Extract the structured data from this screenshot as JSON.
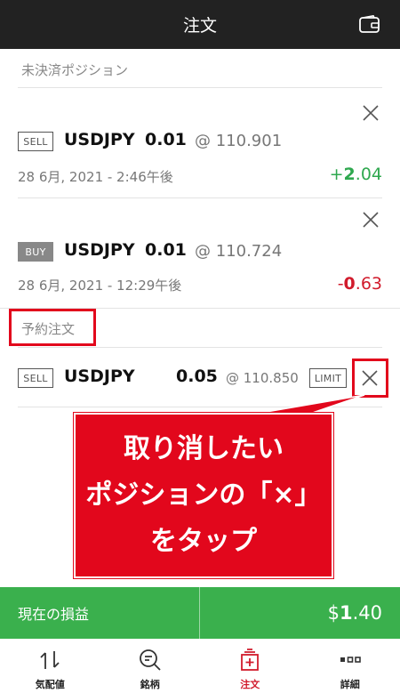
{
  "header": {
    "title": "注文",
    "wallet_icon": "wallet-icon"
  },
  "positions": {
    "section_label": "未決済ポジション",
    "items": [
      {
        "side": "SELL",
        "symbol": "USDJPY",
        "quantity": "0.01",
        "price": "@ 110.901",
        "date": "28 6月, 2021 - 2:46午後",
        "pl_sign": "+",
        "pl_int": "2",
        "pl_dec": ".04",
        "pl_color": "#2fa84f"
      },
      {
        "side": "BUY",
        "symbol": "USDJPY",
        "quantity": "0.01",
        "price": "@ 110.724",
        "date": "28 6月, 2021 - 12:29午後",
        "pl_sign": "-",
        "pl_int": "0",
        "pl_dec": ".63",
        "pl_color": "#d11b2c"
      }
    ]
  },
  "orders": {
    "section_label": "予約注文",
    "items": [
      {
        "side": "SELL",
        "symbol": "USDJPY",
        "quantity": "0.05",
        "price": "@ 110.850",
        "type": "LIMIT"
      }
    ]
  },
  "callout": {
    "line1": "取り消したい",
    "line2": "ポジションの「×」",
    "line3": "をタップ"
  },
  "summary": {
    "label": "現在の損益",
    "value_prefix": "$",
    "value_int": "1",
    "value_dec": ".40"
  },
  "nav": [
    {
      "label": "気配値",
      "icon": "quotes-icon"
    },
    {
      "label": "銘柄",
      "icon": "search-icon"
    },
    {
      "label": "注文",
      "icon": "orders-icon",
      "active": true
    },
    {
      "label": "詳細",
      "icon": "more-icon"
    }
  ],
  "colors": {
    "accent_red": "#e2071c",
    "profit_green": "#2fa84f",
    "loss_red": "#d11b2c",
    "bar_green": "#3ab04d"
  }
}
